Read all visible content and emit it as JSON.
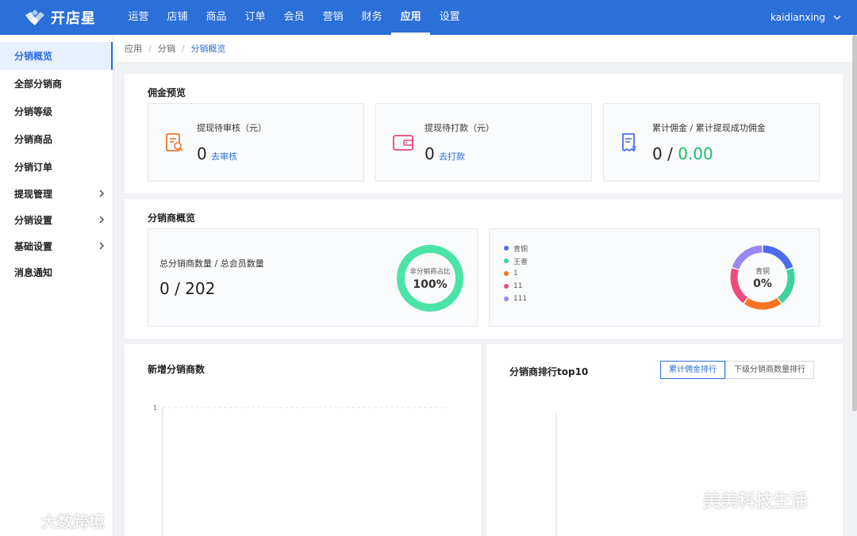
{
  "app": {
    "name": "开店星",
    "user": "kaidianxing"
  },
  "nav": [
    "运营",
    "店铺",
    "商品",
    "订单",
    "会员",
    "营销",
    "财务",
    "应用",
    "设置"
  ],
  "nav_active": "应用",
  "sidebar": [
    {
      "label": "分销概览",
      "active": true,
      "expandable": false
    },
    {
      "label": "全部分销商",
      "active": false,
      "expandable": false
    },
    {
      "label": "分销等级",
      "active": false,
      "expandable": false
    },
    {
      "label": "分销商品",
      "active": false,
      "expandable": false
    },
    {
      "label": "分销订单",
      "active": false,
      "expandable": false
    },
    {
      "label": "提现管理",
      "active": false,
      "expandable": true
    },
    {
      "label": "分销设置",
      "active": false,
      "expandable": true
    },
    {
      "label": "基础设置",
      "active": false,
      "expandable": true
    },
    {
      "label": "消息通知",
      "active": false,
      "expandable": false
    }
  ],
  "breadcrumb": [
    "应用",
    "分销",
    "分销概览"
  ],
  "commission": {
    "title": "佣金预览",
    "cards": [
      {
        "label": "提现待审核（元）",
        "value": "0",
        "link": "去审核",
        "icon": "audit-document-icon",
        "color": "#e8772e"
      },
      {
        "label": "提现待打款（元）",
        "value": "0",
        "link": "去打款",
        "icon": "wallet-icon",
        "color": "#e5487a"
      },
      {
        "label": "累计佣金 / 累计提现成功佣金",
        "value_a": "0",
        "value_sep": "/",
        "value_b": "0.00",
        "icon": "receipt-yuan-icon",
        "color": "#4a6cf0"
      }
    ]
  },
  "distributor": {
    "title": "分销商概览",
    "count_label": "总分销商数量 / 总会员数量",
    "count_value": "0 / 202",
    "ring_label": "非分销商占比",
    "ring_value": "100%",
    "ring_fraction": 1.0,
    "ring_color": "#4be3a8",
    "legend": [
      {
        "name": "青铜",
        "color": "#4a6cf0"
      },
      {
        "name": "王者",
        "color": "#3dd39c"
      },
      {
        "name": "1",
        "color": "#f57422"
      },
      {
        "name": "11",
        "color": "#ef4a7a"
      },
      {
        "name": "111",
        "color": "#9a86f5"
      }
    ],
    "donut_label": "青铜",
    "donut_value": "0%"
  },
  "new_distributors": {
    "title": "新增分销商数",
    "chart_data": {
      "type": "line",
      "y_ticks": [
        "1"
      ],
      "series": []
    }
  },
  "ranking": {
    "title": "分销商排行top10",
    "tabs": [
      "累计佣金排行",
      "下级分销商数量排行"
    ],
    "active_tab": 0
  },
  "watermarks": [
    "大数跨境",
    "美美科技生活"
  ]
}
